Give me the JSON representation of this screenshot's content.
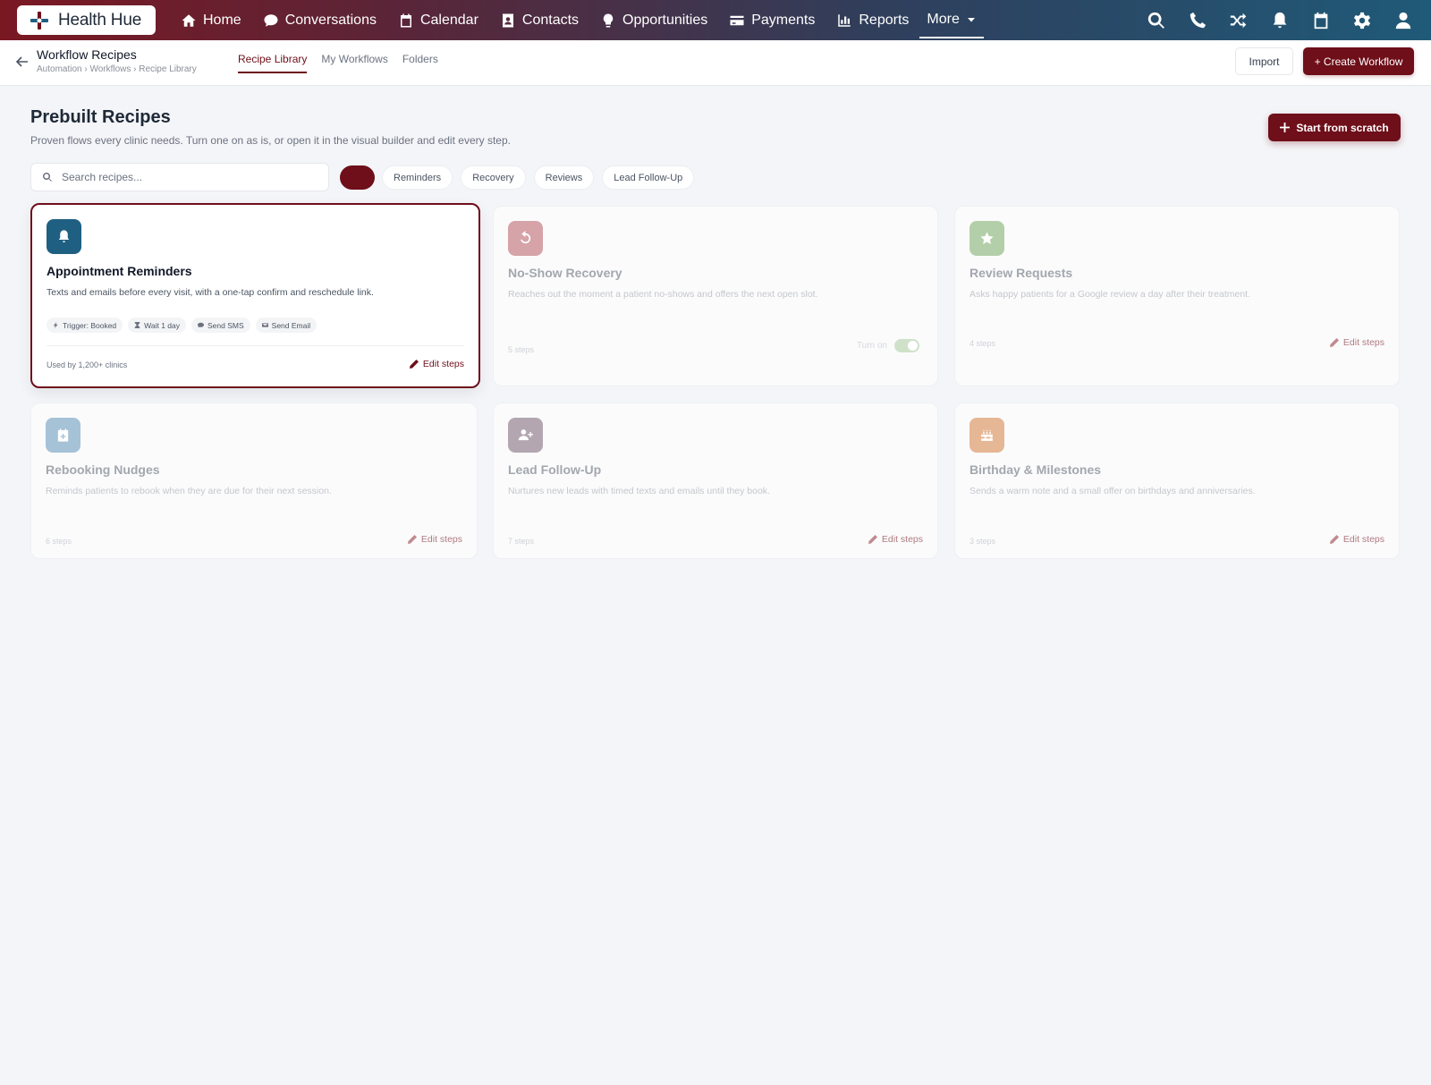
{
  "app": {
    "brand": "Health Hue",
    "nav": [
      {
        "label": "Home",
        "icon": "home-icon"
      },
      {
        "label": "Conversations",
        "icon": "chat-icon"
      },
      {
        "label": "Calendar",
        "icon": "calendar-icon"
      },
      {
        "label": "Contacts",
        "icon": "contact-card-icon"
      },
      {
        "label": "Opportunities",
        "icon": "lightbulb-icon"
      },
      {
        "label": "Payments",
        "icon": "credit-card-icon"
      },
      {
        "label": "Reports",
        "icon": "bar-chart-icon"
      }
    ],
    "more_label": "More",
    "right_icons": [
      "search-icon",
      "phone-icon",
      "shuffle-icon",
      "bell-icon",
      "calendar-icon",
      "gear-icon",
      "user-icon"
    ]
  },
  "subheader": {
    "title": "Workflow Recipes",
    "breadcrumb": "Automation › Workflows › Recipe Library",
    "tabs": [
      "Recipe Library",
      "My Workflows",
      "Folders"
    ],
    "active_tab": "Recipe Library",
    "import_label": "Import",
    "create_label": "+ Create Workflow"
  },
  "page": {
    "title": "Prebuilt Recipes",
    "subtitle": "Proven flows every clinic needs. Turn one on as is, or open it in the visual builder and edit every step.",
    "scratch_label": "Start from scratch",
    "search_placeholder": "Search recipes...",
    "filters": [
      "Reminders",
      "Recovery",
      "Reviews",
      "Lead Follow-Up"
    ]
  },
  "cards": [
    {
      "title": "Appointment Reminders",
      "desc": "Texts and emails before every visit, with a one-tap confirm and reschedule link.",
      "icon": "bell-icon",
      "color": "#1f5f82",
      "tags": [
        {
          "label": "Trigger: Booked",
          "icon": "bolt-icon"
        },
        {
          "label": "Wait 1 day",
          "icon": "hourglass-icon"
        },
        {
          "label": "Send SMS",
          "icon": "chat-icon"
        },
        {
          "label": "Send Email",
          "icon": "mail-icon"
        }
      ],
      "footer": "Used by 1,200+ clinics",
      "edit_label": "Edit steps"
    },
    {
      "title": "No-Show Recovery",
      "desc": "Reaches out the moment a patient no-shows and offers the next open slot.",
      "icon": "undo-icon",
      "color": "#d5a3a8",
      "footer": "5 steps",
      "toggle_label": "Turn on"
    },
    {
      "title": "Review Requests",
      "desc": "Asks happy patients for a Google review a day after their treatment.",
      "icon": "star-icon",
      "color": "#b3cfa9",
      "footer": "4 steps",
      "edit_label": "Edit steps"
    },
    {
      "title": "Rebooking Nudges",
      "desc": "Reminds patients to rebook when they are due for their next session.",
      "icon": "calendar-plus-icon",
      "color": "#a5c2d6",
      "footer": "6 steps",
      "edit_label": "Edit steps"
    },
    {
      "title": "Lead Follow-Up",
      "desc": "Nurtures new leads with timed texts and emails until they book.",
      "icon": "user-plus-icon",
      "color": "#b3a6b1",
      "footer": "7 steps",
      "edit_label": "Edit steps"
    },
    {
      "title": "Birthday & Milestones",
      "desc": "Sends a warm note and a small offer on birthdays and anniversaries.",
      "icon": "cake-icon",
      "color": "#e6b795",
      "footer": "3 steps",
      "edit_label": "Edit steps"
    }
  ]
}
